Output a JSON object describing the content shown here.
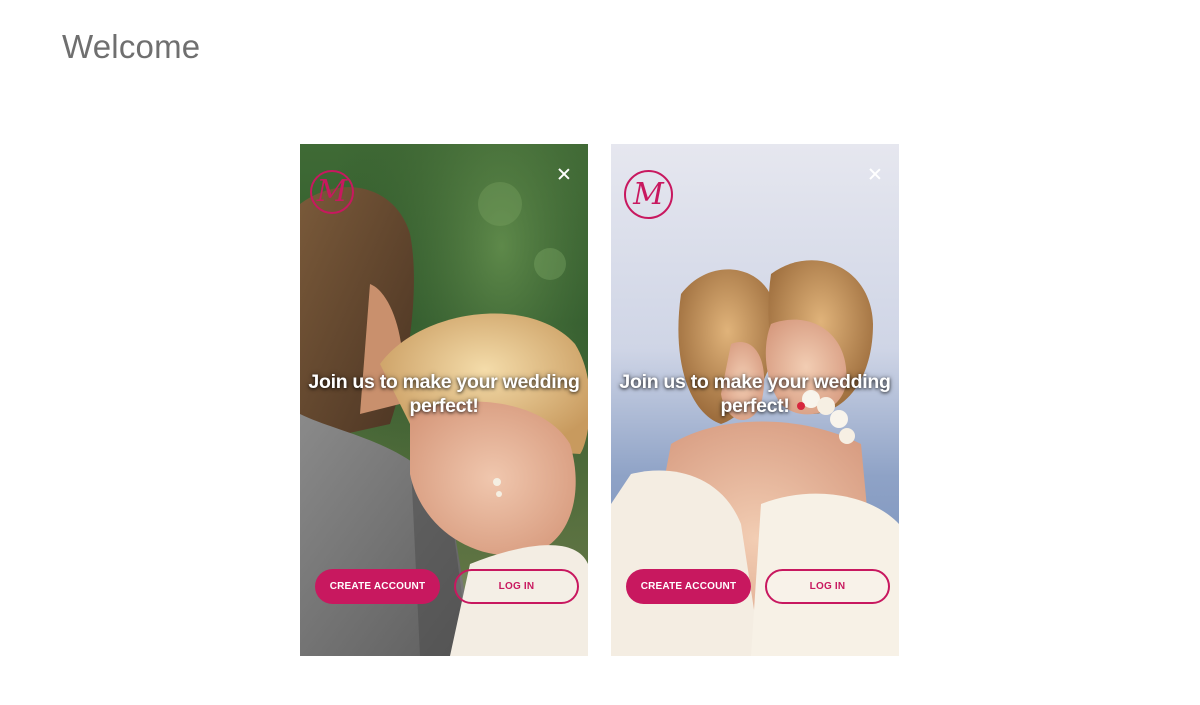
{
  "page": {
    "title": "Welcome"
  },
  "colors": {
    "brand": "#c8185f",
    "title_text": "#6f6f6f",
    "headline_text": "#ffffff"
  },
  "screens": [
    {
      "logo_letter": "M",
      "headline": "Join us to make your wedding perfect!",
      "create_account_label": "CREATE ACCOUNT",
      "login_label": "LOG IN",
      "close_icon": "close-icon",
      "background": "photo of bride resting head on groom's shoulder, green foliage backdrop"
    },
    {
      "logo_letter": "M",
      "headline": "Join us to make your wedding perfect!",
      "create_account_label": "CREATE ACCOUNT",
      "login_label": "LOG IN",
      "close_icon": "close-icon",
      "background": "photo of two brides embracing by the sea"
    }
  ]
}
